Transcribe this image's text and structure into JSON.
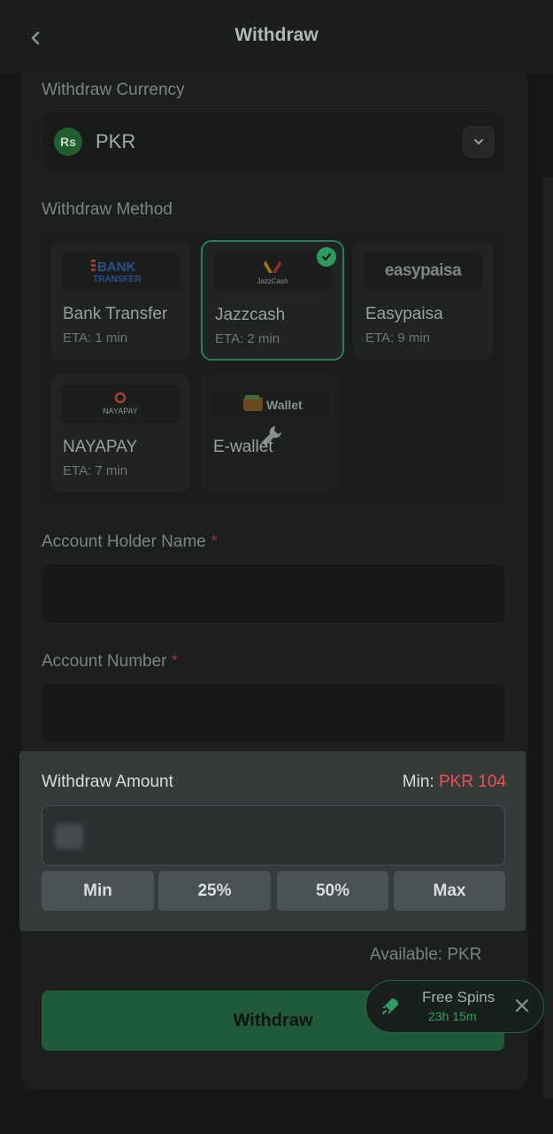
{
  "header": {
    "title": "Withdraw"
  },
  "currency": {
    "label": "Withdraw Currency",
    "badge": "Rs",
    "value": "PKR"
  },
  "method": {
    "label": "Withdraw Method",
    "options": [
      {
        "name": "Bank Transfer",
        "eta": "ETA: 1 min",
        "logo_line1": "BANK",
        "logo_line2": "TRANSFER"
      },
      {
        "name": "Jazzcash",
        "eta": "ETA: 2 min",
        "logo_text": "JazzCash",
        "selected": true
      },
      {
        "name": "Easypaisa",
        "eta": "ETA: 9 min",
        "logo_text": "easypaisa"
      },
      {
        "name": "NAYAPAY",
        "eta": "ETA: 7 min",
        "logo_text": "NAYAPAY"
      },
      {
        "name": "E-wallet",
        "eta": "",
        "logo_text": "Wallet",
        "maintenance": true
      }
    ]
  },
  "account_holder": {
    "label": "Account Holder Name",
    "required_mark": "*"
  },
  "account_number": {
    "label": "Account Number",
    "required_mark": "*"
  },
  "amount": {
    "label": "Withdraw Amount",
    "min_prefix": "Min:",
    "min_value": "PKR 104",
    "buttons": [
      "Min",
      "25%",
      "50%",
      "Max"
    ]
  },
  "available": "Available: PKR",
  "submit": "Withdraw",
  "free_spins": {
    "title": "Free Spins",
    "timer": "23h 15m"
  },
  "colors": {
    "accent_green": "#2c9b5e",
    "min_red": "#ef4f4f",
    "background": "#141716"
  }
}
